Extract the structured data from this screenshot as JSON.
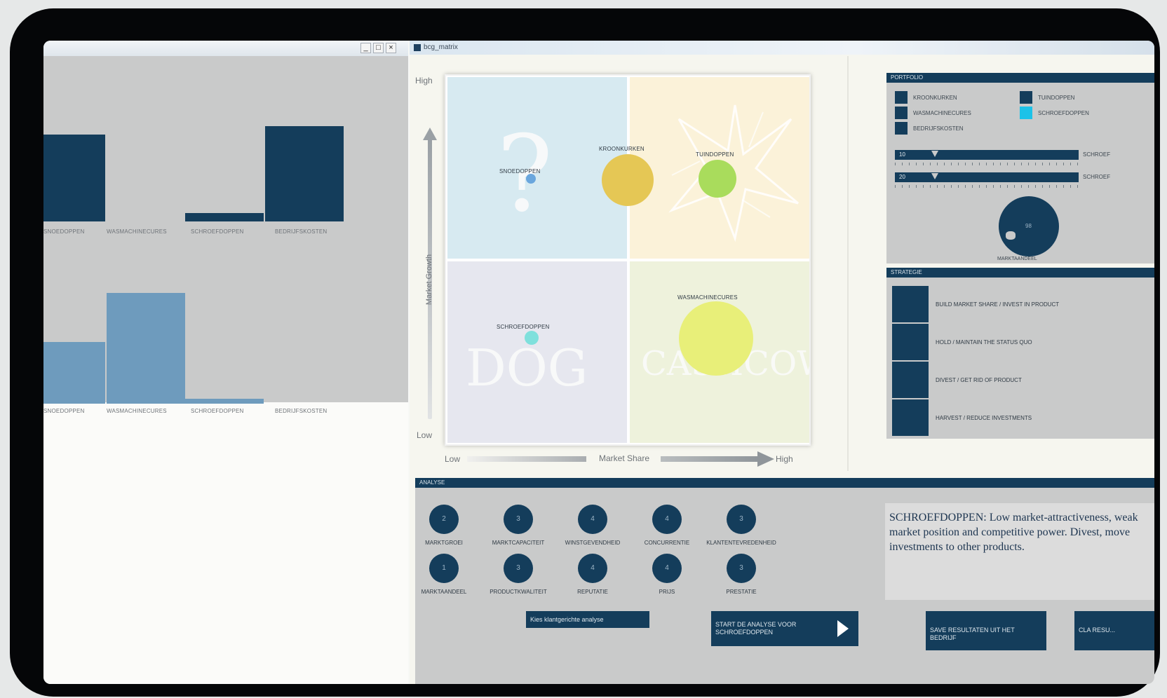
{
  "left_window": {
    "window_buttons": [
      "_",
      "□",
      "×"
    ],
    "top_chart": {
      "categories": [
        "SNOEDOPPEN",
        "WASMACHINECURES",
        "SCHROEFDOPPEN",
        "BEDRIJFSKOSTEN"
      ],
      "bar_color": "#143d5b"
    },
    "bottom_chart": {
      "categories": [
        "SNOEDOPPEN",
        "WASMACHINECURES",
        "SCHROEFDOPPEN",
        "BEDRIJFSKOSTEN"
      ],
      "bar_color": "#6e9bbd"
    }
  },
  "main_window": {
    "title": "bcg_matrix",
    "matrix": {
      "y_high": "High",
      "y_low": "Low",
      "y_title": "Market Growth",
      "x_low": "Low",
      "x_title": "Market Share",
      "x_high": "High",
      "quadrant_words": [
        "?",
        "",
        "DOG",
        "CASHCOW"
      ],
      "bubbles": [
        {
          "label": "SNOEDOPPEN",
          "color": "#6aa6dd"
        },
        {
          "label": "KROONKURKEN",
          "color": "#e5c755"
        },
        {
          "label": "TUINDOPPEN",
          "color": "#a9dc5c"
        },
        {
          "label": "WASMACHINECURES",
          "color": "#e8ef79"
        },
        {
          "label": "SCHROEFDOPPEN",
          "color": "#7fe0dc"
        }
      ]
    }
  },
  "portfolio": {
    "header": "PORTFOLIO",
    "legend": [
      "KROONKURKEN",
      "WASMACHINECURES",
      "BEDRIJFSKOSTEN",
      "TUINDOPPEN",
      "SCHROEFDOPPEN"
    ],
    "legend_colors": [
      "#143d5b",
      "#143d5b",
      "#143d5b",
      "#143d5b",
      "#1cc2e8"
    ],
    "sliders": [
      {
        "label": "10",
        "end": "SCHROEF"
      },
      {
        "label": "20",
        "end": "SCHROEF"
      }
    ],
    "pie_label": "MARKTAANDEEL",
    "pie_center": "98"
  },
  "strategy": {
    "header": "STRATEGIE",
    "items": [
      "BUILD MARKET SHARE / INVEST IN PRODUCT",
      "HOLD / MAINTAIN THE STATUS QUO",
      "DIVEST / GET RID OF PRODUCT",
      "HARVEST / REDUCE INVESTMENTS"
    ]
  },
  "analysis": {
    "header": "ANALYSE",
    "knobs_row1": [
      {
        "value": "2",
        "label": "MARKTGROEI"
      },
      {
        "value": "3",
        "label": "MARKTCAPACITEIT"
      },
      {
        "value": "4",
        "label": "WINSTGEVENDHEID"
      },
      {
        "value": "4",
        "label": "CONCURRENTIE"
      },
      {
        "value": "3",
        "label": "KLANTENTEVREDENHEID"
      }
    ],
    "knobs_row2": [
      {
        "value": "1",
        "label": "MARKTAANDEEL"
      },
      {
        "value": "3",
        "label": "PRODUCTKWALITEIT"
      },
      {
        "value": "4",
        "label": "REPUTATIE"
      },
      {
        "value": "4",
        "label": "PRIJS"
      },
      {
        "value": "3",
        "label": "PRESTATIE"
      }
    ],
    "description": "SCHROEFDOPPEN: Low market-attractiveness, weak market position and competitive power. Divest, move investments to other products.",
    "small_button": "Kies klantgerichte analyse",
    "start_button": "START DE ANALYSE VOOR SCHROEFDOPPEN",
    "save_button": "SAVE RESULTATEN UIT HET BEDRIJF",
    "extra_button": "CLA RESU..."
  }
}
